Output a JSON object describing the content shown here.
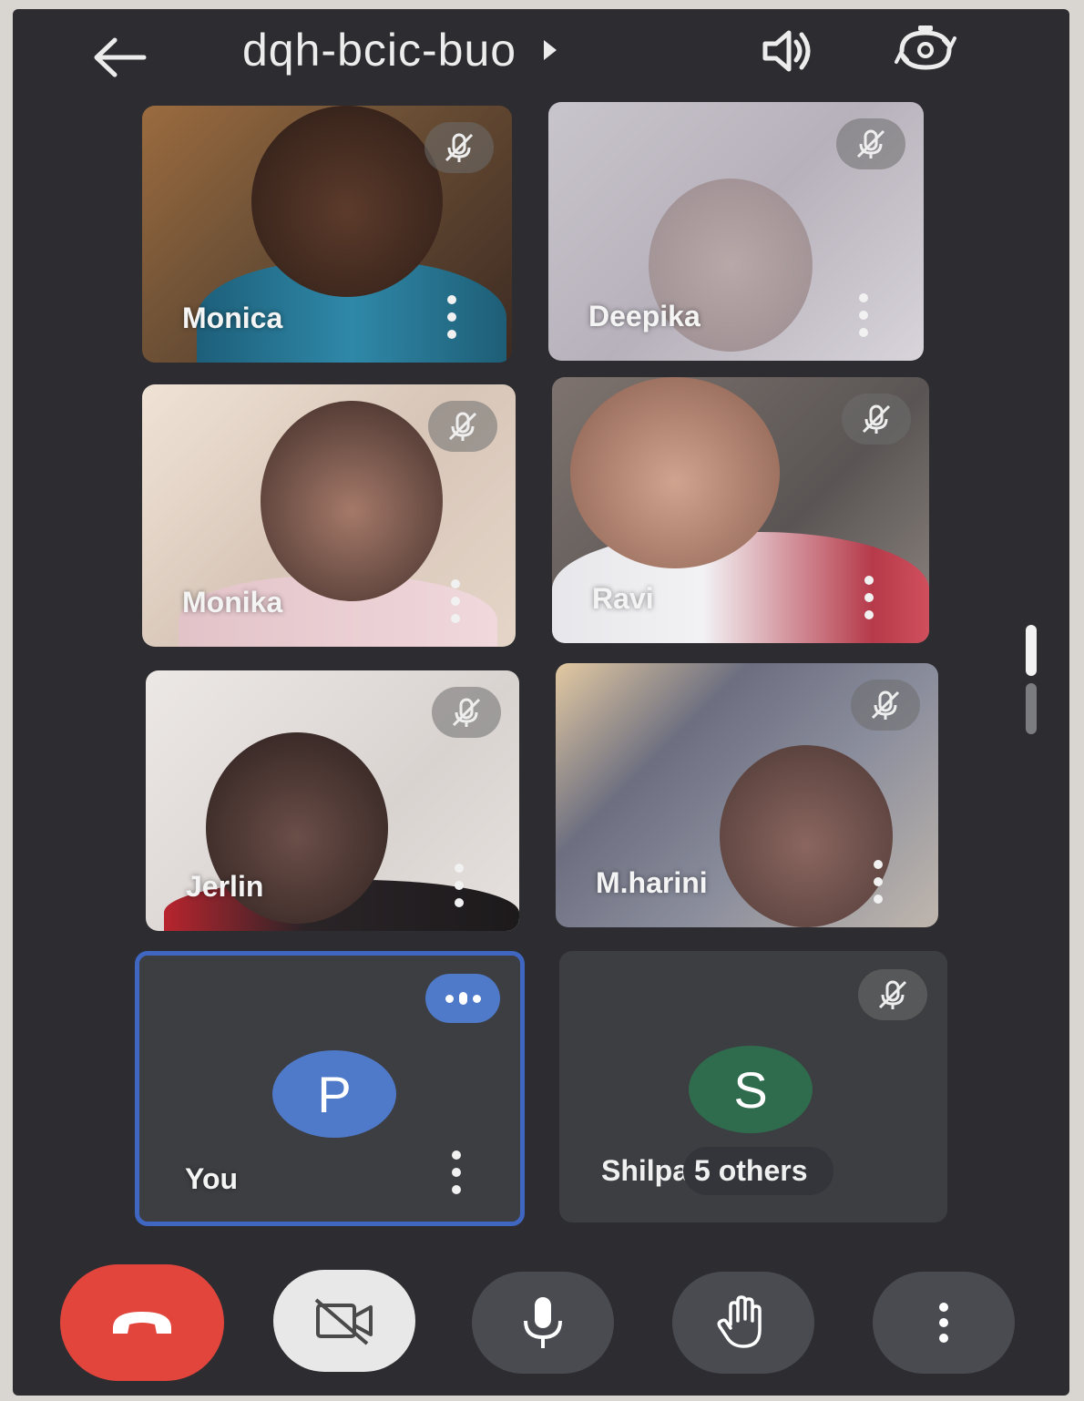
{
  "header": {
    "meeting_code": "dqh-bcic-buo",
    "icons": {
      "back": "arrow-left-icon",
      "caret": "caret-right-icon",
      "speaker": "speaker-icon",
      "switch_camera": "switch-camera-icon"
    }
  },
  "participants": [
    {
      "name": "Monica",
      "muted": true
    },
    {
      "name": "Deepika",
      "muted": true
    },
    {
      "name": "Monika",
      "muted": true
    },
    {
      "name": "Ravi",
      "muted": true
    },
    {
      "name": "Jerlin",
      "muted": true
    },
    {
      "name": "M.harini",
      "muted": true
    }
  ],
  "self_tile": {
    "label": "You",
    "avatar_initial": "P",
    "avatar_color": "#4f79c9",
    "highlight_color": "#3f66c0"
  },
  "others_tile": {
    "label_name": "Shilpa",
    "label_suffix": "5 others",
    "avatar_initial": "S",
    "avatar_color": "#2f6b4d",
    "muted": true
  },
  "controls": {
    "end_call": {
      "icon": "end-call-icon",
      "color": "#e2453c"
    },
    "camera": {
      "icon": "camera-off-icon",
      "color": "#e8e8e8"
    },
    "mic": {
      "icon": "microphone-icon"
    },
    "raise_hand": {
      "icon": "raise-hand-icon"
    },
    "more": {
      "icon": "more-vertical-icon"
    }
  },
  "colors": {
    "background": "#2d2d31",
    "tile_dark": "#3d3e42",
    "control_dark": "#4a4b50"
  }
}
